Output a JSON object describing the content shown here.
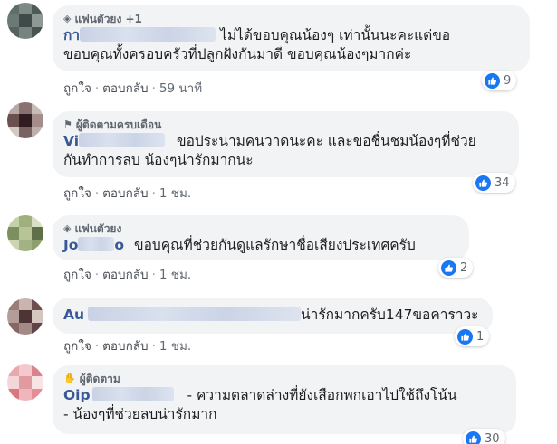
{
  "comments": [
    {
      "badge": "แฟนตัวยง +1",
      "badge_icon": "diamond-icon",
      "name_visible": "กา",
      "lines": [
        "ไม่ได้ขอบคุณน้องๆ เท่านั้นนะคะแต่ขอ",
        "ขอบคุณทั้งครอบครัวที่ปลูกฝังกันมาดี ขอบคุณน้องๆมากค่ะ"
      ],
      "like": "ถูกใจ",
      "reply": "ตอบกลับ",
      "time": "59 นาที",
      "reactions": "9",
      "avatar": [
        "#5f6e6a",
        "#7d8a86",
        "#4e5a57",
        "#6a7a75",
        "#3f4b48",
        "#8e9995",
        "#55625f",
        "#76837f",
        "#465350"
      ]
    },
    {
      "badge": "ผู้ติดตามครบเดือน",
      "badge_icon": "flag-icon",
      "name_visible": "Vi",
      "lines": [
        "ขอประนามคนวาดนะคะ และขอชื่นชมน้องๆที่ช่วย",
        "กันทำการลบ น้องๆน่ารักมากนะ"
      ],
      "like": "ถูกใจ",
      "reply": "ตอบกลับ",
      "time": "1 ชม.",
      "reactions": "34",
      "avatar": [
        "#b9a9a6",
        "#8a7170",
        "#c9bcb8",
        "#6b5050",
        "#2f1d22",
        "#a48e8c",
        "#d4c8c5",
        "#7a6262",
        "#bfb0ad"
      ]
    },
    {
      "badge": "แฟนตัวยง",
      "badge_icon": "diamond-icon",
      "name_visible": "Jo",
      "name_tail": "o",
      "lines": [
        "ขอบคุณที่ช่วยกันดูแลรักษาชื่อเสียงประเทศครับ"
      ],
      "like": "ถูกใจ",
      "reply": "ตอบกลับ",
      "time": "1 ชม.",
      "reactions": "2",
      "avatar": [
        "#c5d1a8",
        "#9fb07c",
        "#d8e0c4",
        "#7c8f5e",
        "#b7c596",
        "#5f7048",
        "#cbd5b2",
        "#a3b282",
        "#8e9f6e"
      ]
    },
    {
      "name_visible": "Au",
      "lines": [
        "น่ารักมากครับ147ขอคาราวะ"
      ],
      "like": "ถูกใจ",
      "reply": "ตอบกลับ",
      "time": "1 ชม.",
      "reactions": "1",
      "avatar": [
        "#9a7c78",
        "#c9b4ae",
        "#6e4e4d",
        "#b29d98",
        "#4d3535",
        "#d6c6c0",
        "#856766",
        "#a58985",
        "#5e4444"
      ]
    },
    {
      "badge": "ผู้ติดตาม",
      "badge_icon": "wave-hand-icon",
      "name_visible": "Oip",
      "lines": [
        "- ความตลาดล่างที่ยังเสือกพกเอาไปใช้ถึงโน้น",
        "- น้องๆที่ช่วยลบน่ารักมาก"
      ],
      "like": "ถูกใจ",
      "reply": "ตอบกลับ",
      "time": "",
      "reactions": "30",
      "avatar": [
        "#e8a9ae",
        "#f3c9cc",
        "#d9838c",
        "#f5d6d8",
        "#e29aa1",
        "#f9e4e5",
        "#d97680",
        "#efb6bb",
        "#e38d95"
      ]
    }
  ],
  "colors": {
    "bubble": "#f2f3f5",
    "name": "#385898",
    "like_blue": "#1877f2",
    "meta": "#606770"
  }
}
